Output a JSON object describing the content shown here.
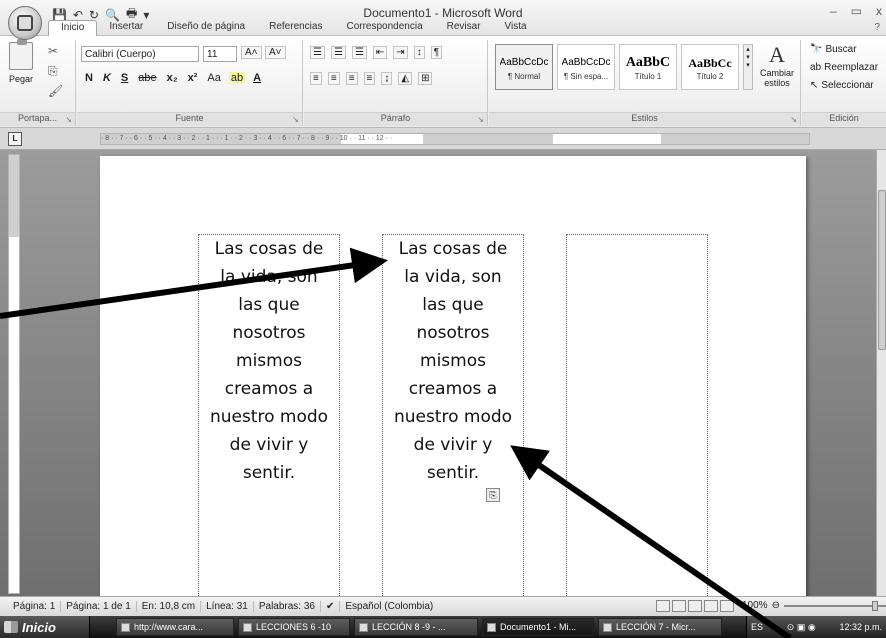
{
  "window": {
    "title": "Documento1 - Microsoft Word",
    "minimize": "–",
    "restore": "▭",
    "close": "x"
  },
  "qat": {
    "save": "💾",
    "undo": "↶",
    "redo": "↻",
    "print_preview": "🔍",
    "print": "🖶",
    "more": "▾"
  },
  "tabs": [
    "Inicio",
    "Insertar",
    "Diseño de página",
    "Referencias",
    "Correspondencia",
    "Revisar",
    "Vista"
  ],
  "ribbon": {
    "clipboard": {
      "label": "Portapa...",
      "paste": "Pegar"
    },
    "font": {
      "label": "Fuente",
      "family": "Calibri (Cuerpo)",
      "size": "11",
      "bold": "N",
      "italic": "K",
      "underline": "S",
      "strike": "abe",
      "subscript": "x₂",
      "superscript": "x²",
      "case": "Aa",
      "grow": "A˄",
      "shrink": "A˅",
      "highlight": "ab",
      "color": "A"
    },
    "paragraph": {
      "label": "Párrafo"
    },
    "styles": {
      "label": "Estilos",
      "items": [
        {
          "sample": "AaBbCcDc",
          "name": "¶ Normal"
        },
        {
          "sample": "AaBbCcDc",
          "name": "¶ Sin espa..."
        },
        {
          "sample": "AaBbC",
          "name": "Título 1"
        },
        {
          "sample": "AaBbCc",
          "name": "Título 2"
        }
      ],
      "change": "Cambiar estilos"
    },
    "editing": {
      "label": "Edición",
      "find": "Buscar",
      "replace": "Reemplazar",
      "select": "Seleccionar"
    }
  },
  "ruler": {
    "h_text": "· 8 · · 7 · · 6 · · 5 · · 4 · · 3 · · 2 · · 1 ·   ·  · 1 · · 2 · · 3 · · 4 ·     · 6 · · 7 · · 8 · · 9 · · 10 · · 11 · · 12 · ·"
  },
  "document": {
    "textbox_lines": [
      "Las cosas de",
      "la vida, son",
      "las que",
      "nosotros",
      "mismos",
      "creamos a",
      "nuestro modo",
      "de vivir y",
      "sentir."
    ]
  },
  "status": {
    "page": "Página: 1",
    "pages": "Página: 1 de 1",
    "position": "En: 10,8 cm",
    "line": "Línea: 31",
    "words": "Palabras: 36",
    "language": "Español (Colombia)",
    "zoom": "100%"
  },
  "taskbar": {
    "start": "Inicio",
    "tasks": [
      {
        "label": "http://www.cara..."
      },
      {
        "label": "LECCIONES 6 -10"
      },
      {
        "label": "LECCIÓN 8 -9 - ..."
      },
      {
        "label": "Documento1 - Mi..."
      },
      {
        "label": "LECCIÓN 7 - Micr..."
      }
    ],
    "lang": "ES",
    "time": "12:32 p.m."
  }
}
